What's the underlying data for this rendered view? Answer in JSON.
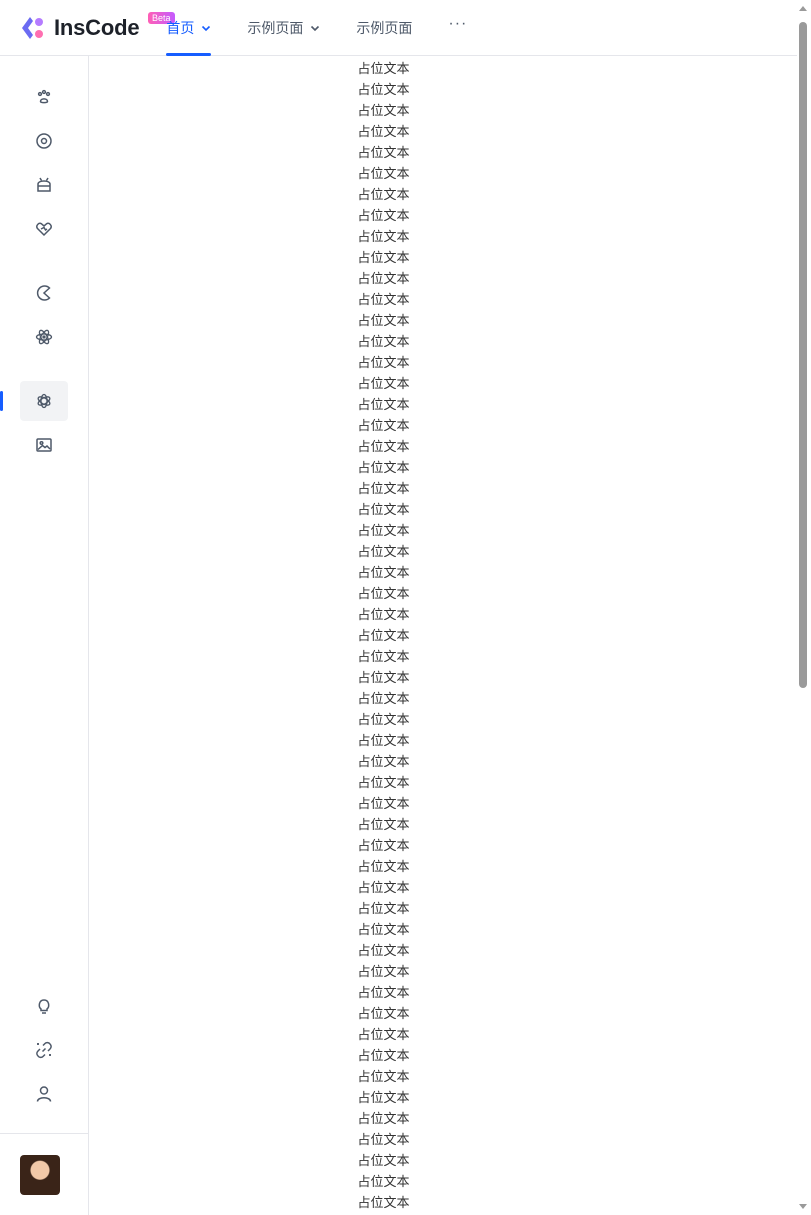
{
  "app": {
    "brand_name": "InsCode",
    "badge": "Beta",
    "accent_color": "#165dff"
  },
  "nav": {
    "items": [
      {
        "label": "首页",
        "active": true,
        "has_dropdown": true
      },
      {
        "label": "示例页面",
        "active": false,
        "has_dropdown": true
      },
      {
        "label": "示例页面",
        "active": false,
        "has_dropdown": false
      }
    ],
    "more_label": "···"
  },
  "sidebar": {
    "items": [
      {
        "icon": "paw-icon",
        "active": false
      },
      {
        "icon": "target-icon",
        "active": false
      },
      {
        "icon": "android-icon",
        "active": false
      },
      {
        "icon": "heart-icon",
        "active": false
      },
      {
        "icon": "pacman-icon",
        "active": false
      },
      {
        "icon": "atom-icon",
        "active": false
      },
      {
        "icon": "openai-icon",
        "active": true
      },
      {
        "icon": "image-icon",
        "active": false
      }
    ],
    "bottom_items": [
      {
        "icon": "lightbulb-icon"
      },
      {
        "icon": "link-icon"
      },
      {
        "icon": "user-icon"
      }
    ]
  },
  "content": {
    "rows": [
      "占位文本",
      "占位文本",
      "占位文本",
      "占位文本",
      "占位文本",
      "占位文本",
      "占位文本",
      "占位文本",
      "占位文本",
      "占位文本",
      "占位文本",
      "占位文本",
      "占位文本",
      "占位文本",
      "占位文本",
      "占位文本",
      "占位文本",
      "占位文本",
      "占位文本",
      "占位文本",
      "占位文本",
      "占位文本",
      "占位文本",
      "占位文本",
      "占位文本",
      "占位文本",
      "占位文本",
      "占位文本",
      "占位文本",
      "占位文本",
      "占位文本",
      "占位文本",
      "占位文本",
      "占位文本",
      "占位文本",
      "占位文本",
      "占位文本",
      "占位文本",
      "占位文本",
      "占位文本",
      "占位文本",
      "占位文本",
      "占位文本",
      "占位文本",
      "占位文本",
      "占位文本",
      "占位文本",
      "占位文本",
      "占位文本",
      "占位文本",
      "占位文本",
      "占位文本",
      "占位文本",
      "占位文本",
      "占位文本"
    ]
  }
}
